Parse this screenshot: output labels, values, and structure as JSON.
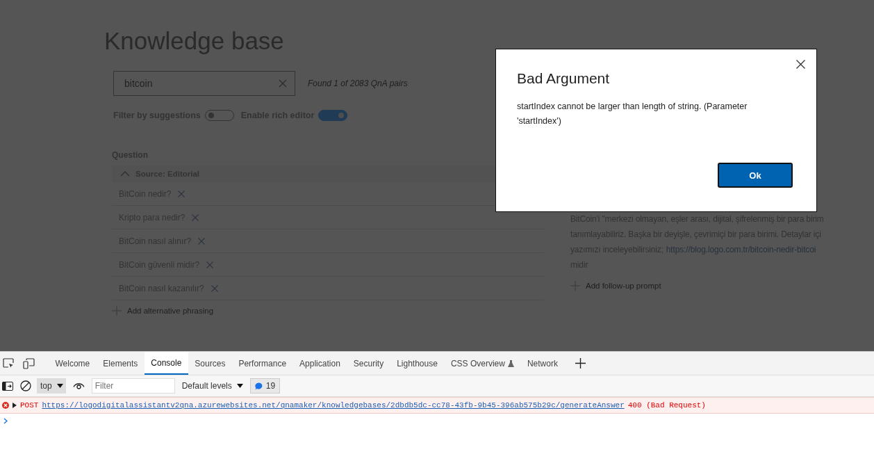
{
  "page": {
    "title": "Knowledge base",
    "search": {
      "value": "bitcoin"
    },
    "found_text": "Found 1 of 2083 QnA pairs",
    "toggles": [
      {
        "label": "Filter by suggestions",
        "on": false
      },
      {
        "label": "Enable rich editor",
        "on": true
      }
    ],
    "question_header": "Question",
    "source": {
      "label": "Source: Editorial",
      "expanded": true
    },
    "questions": [
      {
        "text": "BitCoin nedir?"
      },
      {
        "text": "Kripto para nedir?"
      },
      {
        "text": "BitCoin nasıl alınır?"
      },
      {
        "text": "BitCoin güvenli midir?"
      },
      {
        "text": "BitCoin nasıl kazanılır?"
      }
    ],
    "add_phrasing": "Add alternative phrasing",
    "answer": {
      "lines": [
        {
          "text": "BitCoin'i \"merkezi olmayan, eşler arası, dijital, şifrelenmiş bir para birim"
        },
        {
          "text": "tanımlayabiliriz. Başka bir deyişle, çevrimiçi bir para birimi. Detaylar içi"
        },
        {
          "text": "yazımızı inceleyebilirsiniz;",
          "link": "https://blog.logo.com.tr/bitcoin-nedir-bitcoi"
        },
        {
          "text": "midir"
        }
      ]
    },
    "follow_up": "Add follow-up prompt"
  },
  "dialog": {
    "title": "Bad Argument",
    "message": "startIndex cannot be larger than length of string. (Parameter 'startIndex')",
    "button": "Ok"
  },
  "devtools": {
    "tabs": [
      {
        "label": "Welcome",
        "selected": false,
        "experimental": false
      },
      {
        "label": "Elements",
        "selected": false,
        "experimental": false
      },
      {
        "label": "Console",
        "selected": true,
        "experimental": false
      },
      {
        "label": "Sources",
        "selected": false,
        "experimental": false
      },
      {
        "label": "Performance",
        "selected": false,
        "experimental": false
      },
      {
        "label": "Application",
        "selected": false,
        "experimental": false
      },
      {
        "label": "Security",
        "selected": false,
        "experimental": false
      },
      {
        "label": "Lighthouse",
        "selected": false,
        "experimental": false
      },
      {
        "label": "CSS Overview",
        "selected": false,
        "experimental": true
      },
      {
        "label": "Network",
        "selected": false,
        "experimental": false
      }
    ],
    "context": "top",
    "filter_placeholder": "Filter",
    "levels": "Default levels",
    "message_count": "19",
    "messages": [
      {
        "kind": "error",
        "method": "POST",
        "url": "https://logodigitalassistantv2qna.azurewebsites.net/qnamaker/knowledgebases/2dbdb5dc-cc78-43fb-9b45-396ab575b29c/generateAnswer",
        "status": "400 (Bad Request)"
      }
    ]
  }
}
